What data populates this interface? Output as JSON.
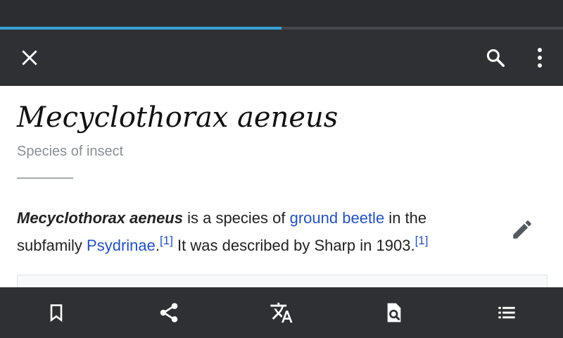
{
  "loading": {
    "progress_fraction": 0.5
  },
  "toolbar": {
    "close_icon": "close-icon",
    "search_icon": "search-icon",
    "overflow_icon": "more-vert-icon"
  },
  "article": {
    "title": "Mecyclothorax aeneus",
    "description": "Species of insect",
    "lead": {
      "bold_name": "Mecyclothorax aeneus",
      "text_1": " is a species of ",
      "link_1": "ground beetle",
      "text_2": " in the subfamily ",
      "link_2": "Psydrinae",
      "text_3": ".",
      "ref_1": "[1]",
      "text_4": " It was described by Sharp in 1903.",
      "ref_2": "[1]"
    },
    "edit_icon": "pencil-icon"
  },
  "bottom_bar": {
    "items": [
      {
        "icon": "bookmark-icon"
      },
      {
        "icon": "share-icon"
      },
      {
        "icon": "translate-icon"
      },
      {
        "icon": "find-in-page-icon"
      },
      {
        "icon": "contents-list-icon"
      }
    ]
  },
  "colors": {
    "toolbar": "#2f3034",
    "accent_progress": "#36a2d6",
    "link": "#2451b8"
  }
}
